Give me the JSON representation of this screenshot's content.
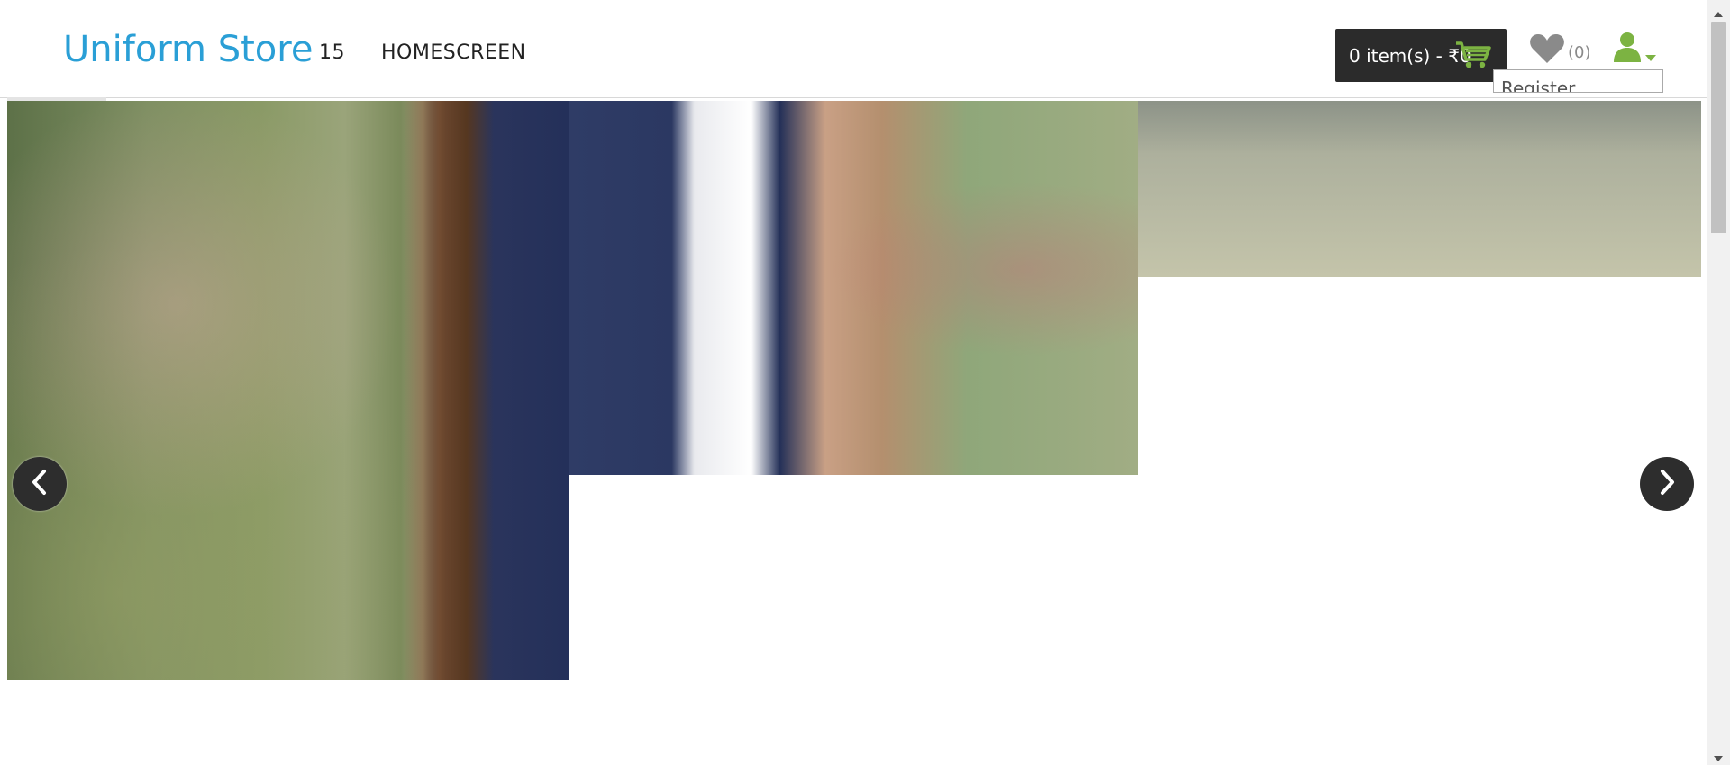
{
  "header": {
    "logo": "Uniform Store",
    "nav": [
      {
        "label": "15"
      },
      {
        "label": "HOMESCREEN"
      }
    ],
    "cart_label": "0 item(s) - ₹0",
    "wishlist_count": "(0)",
    "account_dropdown_item": "Register"
  },
  "colors": {
    "brand": "#2a9fd6",
    "cart_background": "#2b2b2b",
    "accent_green": "#7cb342"
  },
  "icons": {
    "cart": "shopping-cart-icon",
    "wishlist": "heart-icon",
    "account": "user-icon",
    "caret": "caret-down-icon",
    "prev": "chevron-left-icon",
    "next": "chevron-right-icon"
  }
}
